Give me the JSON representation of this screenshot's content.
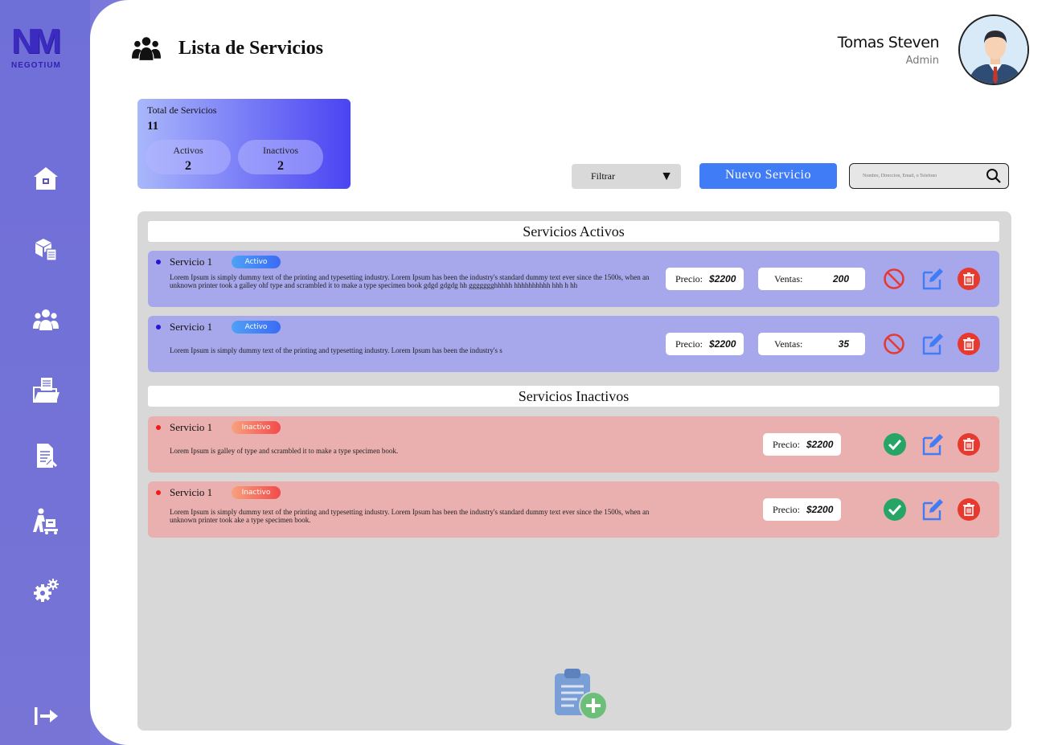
{
  "brand": {
    "mark": "NM",
    "name": "NEGOTIUM"
  },
  "sidebar": {
    "items": [
      {
        "icon": "home-icon"
      },
      {
        "icon": "products-icon"
      },
      {
        "icon": "users-icon"
      },
      {
        "icon": "folder-icon"
      },
      {
        "icon": "document-icon"
      },
      {
        "icon": "delivery-icon"
      },
      {
        "icon": "settings-icon"
      }
    ],
    "logout_icon": "logout-icon"
  },
  "header": {
    "title": "Lista de Servicios",
    "user_name": "Tomas Steven",
    "user_role": "Admin"
  },
  "stats": {
    "total_label": "Total de Servicios",
    "total_value": "11",
    "active_label": "Activos",
    "active_value": "2",
    "inactive_label": "Inactivos",
    "inactive_value": "2"
  },
  "toolbar": {
    "filter_label": "Filtrar",
    "new_label": "Nuevo Servicio",
    "search_placeholder": "Nombre, Direccion, Email, o Telefono"
  },
  "sections": {
    "active_title": "Servicios Activos",
    "inactive_title": "Servicios Inactivos"
  },
  "active_services": [
    {
      "name": "Servicio 1",
      "status": "Activo",
      "description": "Lorem Ipsum is simply dummy text of the printing and typesetting industry. Lorem Ipsum has been the industry's standard dummy text ever since the 1500s, when an unknown printer took a galley ohf type and scrambled it to make a type specimen book gdgd gdgdg  hh ggggggghhhhh hhhhhhhhhh hhh h  hh",
      "price_label": "Precio:",
      "price": "$2200",
      "sales_label": "Ventas:",
      "sales": "200"
    },
    {
      "name": "Servicio 1",
      "status": "Activo",
      "description": "Lorem Ipsum is simply dummy text of the printing and typesetting industry. Lorem Ipsum has been the industry's s",
      "price_label": "Precio:",
      "price": "$2200",
      "sales_label": "Ventas:",
      "sales": "35"
    }
  ],
  "inactive_services": [
    {
      "name": "Servicio 1",
      "status": "Inactivo",
      "description": "Lorem Ipsum is  galley of type and scrambled it to make a type specimen book.",
      "price_label": "Precio:",
      "price": "$2200"
    },
    {
      "name": "Servicio 1",
      "status": "Inactivo",
      "description": "Lorem Ipsum is simply dummy text of the printing and typesetting industry. Lorem Ipsum has been the industry's standard dummy text ever since the 1500s, when an unknown printer took ake a type specimen book.",
      "price_label": "Precio:",
      "price": "$2200"
    }
  ],
  "colors": {
    "sidebar": "#7174d8",
    "accent": "#3f7cf6",
    "active_card": "#a7a8eb",
    "inactive_card": "#eab0af",
    "delete": "#e8392f",
    "enable": "#27a567",
    "disable": "#e53935",
    "edit": "#3f7cf6"
  }
}
